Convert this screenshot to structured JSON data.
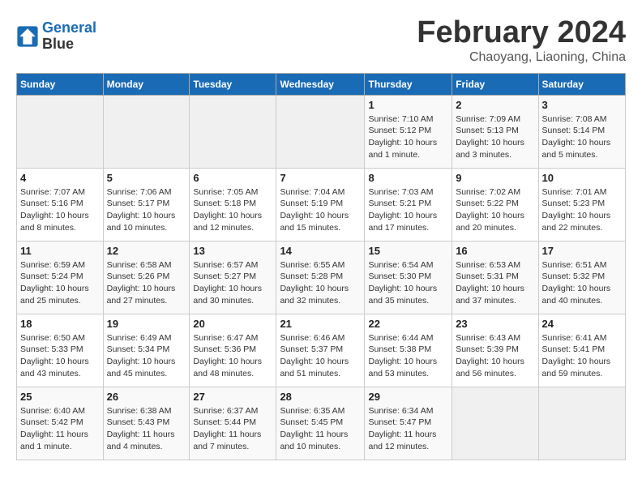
{
  "header": {
    "logo_line1": "General",
    "logo_line2": "Blue",
    "month_year": "February 2024",
    "location": "Chaoyang, Liaoning, China"
  },
  "weekdays": [
    "Sunday",
    "Monday",
    "Tuesday",
    "Wednesday",
    "Thursday",
    "Friday",
    "Saturday"
  ],
  "weeks": [
    [
      {
        "day": "",
        "sunrise": "",
        "sunset": "",
        "daylight": "",
        "empty": true
      },
      {
        "day": "",
        "sunrise": "",
        "sunset": "",
        "daylight": "",
        "empty": true
      },
      {
        "day": "",
        "sunrise": "",
        "sunset": "",
        "daylight": "",
        "empty": true
      },
      {
        "day": "",
        "sunrise": "",
        "sunset": "",
        "daylight": "",
        "empty": true
      },
      {
        "day": "1",
        "sunrise": "Sunrise: 7:10 AM",
        "sunset": "Sunset: 5:12 PM",
        "daylight": "Daylight: 10 hours and 1 minute.",
        "empty": false
      },
      {
        "day": "2",
        "sunrise": "Sunrise: 7:09 AM",
        "sunset": "Sunset: 5:13 PM",
        "daylight": "Daylight: 10 hours and 3 minutes.",
        "empty": false
      },
      {
        "day": "3",
        "sunrise": "Sunrise: 7:08 AM",
        "sunset": "Sunset: 5:14 PM",
        "daylight": "Daylight: 10 hours and 5 minutes.",
        "empty": false
      }
    ],
    [
      {
        "day": "4",
        "sunrise": "Sunrise: 7:07 AM",
        "sunset": "Sunset: 5:16 PM",
        "daylight": "Daylight: 10 hours and 8 minutes.",
        "empty": false
      },
      {
        "day": "5",
        "sunrise": "Sunrise: 7:06 AM",
        "sunset": "Sunset: 5:17 PM",
        "daylight": "Daylight: 10 hours and 10 minutes.",
        "empty": false
      },
      {
        "day": "6",
        "sunrise": "Sunrise: 7:05 AM",
        "sunset": "Sunset: 5:18 PM",
        "daylight": "Daylight: 10 hours and 12 minutes.",
        "empty": false
      },
      {
        "day": "7",
        "sunrise": "Sunrise: 7:04 AM",
        "sunset": "Sunset: 5:19 PM",
        "daylight": "Daylight: 10 hours and 15 minutes.",
        "empty": false
      },
      {
        "day": "8",
        "sunrise": "Sunrise: 7:03 AM",
        "sunset": "Sunset: 5:21 PM",
        "daylight": "Daylight: 10 hours and 17 minutes.",
        "empty": false
      },
      {
        "day": "9",
        "sunrise": "Sunrise: 7:02 AM",
        "sunset": "Sunset: 5:22 PM",
        "daylight": "Daylight: 10 hours and 20 minutes.",
        "empty": false
      },
      {
        "day": "10",
        "sunrise": "Sunrise: 7:01 AM",
        "sunset": "Sunset: 5:23 PM",
        "daylight": "Daylight: 10 hours and 22 minutes.",
        "empty": false
      }
    ],
    [
      {
        "day": "11",
        "sunrise": "Sunrise: 6:59 AM",
        "sunset": "Sunset: 5:24 PM",
        "daylight": "Daylight: 10 hours and 25 minutes.",
        "empty": false
      },
      {
        "day": "12",
        "sunrise": "Sunrise: 6:58 AM",
        "sunset": "Sunset: 5:26 PM",
        "daylight": "Daylight: 10 hours and 27 minutes.",
        "empty": false
      },
      {
        "day": "13",
        "sunrise": "Sunrise: 6:57 AM",
        "sunset": "Sunset: 5:27 PM",
        "daylight": "Daylight: 10 hours and 30 minutes.",
        "empty": false
      },
      {
        "day": "14",
        "sunrise": "Sunrise: 6:55 AM",
        "sunset": "Sunset: 5:28 PM",
        "daylight": "Daylight: 10 hours and 32 minutes.",
        "empty": false
      },
      {
        "day": "15",
        "sunrise": "Sunrise: 6:54 AM",
        "sunset": "Sunset: 5:30 PM",
        "daylight": "Daylight: 10 hours and 35 minutes.",
        "empty": false
      },
      {
        "day": "16",
        "sunrise": "Sunrise: 6:53 AM",
        "sunset": "Sunset: 5:31 PM",
        "daylight": "Daylight: 10 hours and 37 minutes.",
        "empty": false
      },
      {
        "day": "17",
        "sunrise": "Sunrise: 6:51 AM",
        "sunset": "Sunset: 5:32 PM",
        "daylight": "Daylight: 10 hours and 40 minutes.",
        "empty": false
      }
    ],
    [
      {
        "day": "18",
        "sunrise": "Sunrise: 6:50 AM",
        "sunset": "Sunset: 5:33 PM",
        "daylight": "Daylight: 10 hours and 43 minutes.",
        "empty": false
      },
      {
        "day": "19",
        "sunrise": "Sunrise: 6:49 AM",
        "sunset": "Sunset: 5:34 PM",
        "daylight": "Daylight: 10 hours and 45 minutes.",
        "empty": false
      },
      {
        "day": "20",
        "sunrise": "Sunrise: 6:47 AM",
        "sunset": "Sunset: 5:36 PM",
        "daylight": "Daylight: 10 hours and 48 minutes.",
        "empty": false
      },
      {
        "day": "21",
        "sunrise": "Sunrise: 6:46 AM",
        "sunset": "Sunset: 5:37 PM",
        "daylight": "Daylight: 10 hours and 51 minutes.",
        "empty": false
      },
      {
        "day": "22",
        "sunrise": "Sunrise: 6:44 AM",
        "sunset": "Sunset: 5:38 PM",
        "daylight": "Daylight: 10 hours and 53 minutes.",
        "empty": false
      },
      {
        "day": "23",
        "sunrise": "Sunrise: 6:43 AM",
        "sunset": "Sunset: 5:39 PM",
        "daylight": "Daylight: 10 hours and 56 minutes.",
        "empty": false
      },
      {
        "day": "24",
        "sunrise": "Sunrise: 6:41 AM",
        "sunset": "Sunset: 5:41 PM",
        "daylight": "Daylight: 10 hours and 59 minutes.",
        "empty": false
      }
    ],
    [
      {
        "day": "25",
        "sunrise": "Sunrise: 6:40 AM",
        "sunset": "Sunset: 5:42 PM",
        "daylight": "Daylight: 11 hours and 1 minute.",
        "empty": false
      },
      {
        "day": "26",
        "sunrise": "Sunrise: 6:38 AM",
        "sunset": "Sunset: 5:43 PM",
        "daylight": "Daylight: 11 hours and 4 minutes.",
        "empty": false
      },
      {
        "day": "27",
        "sunrise": "Sunrise: 6:37 AM",
        "sunset": "Sunset: 5:44 PM",
        "daylight": "Daylight: 11 hours and 7 minutes.",
        "empty": false
      },
      {
        "day": "28",
        "sunrise": "Sunrise: 6:35 AM",
        "sunset": "Sunset: 5:45 PM",
        "daylight": "Daylight: 11 hours and 10 minutes.",
        "empty": false
      },
      {
        "day": "29",
        "sunrise": "Sunrise: 6:34 AM",
        "sunset": "Sunset: 5:47 PM",
        "daylight": "Daylight: 11 hours and 12 minutes.",
        "empty": false
      },
      {
        "day": "",
        "sunrise": "",
        "sunset": "",
        "daylight": "",
        "empty": true
      },
      {
        "day": "",
        "sunrise": "",
        "sunset": "",
        "daylight": "",
        "empty": true
      }
    ]
  ]
}
